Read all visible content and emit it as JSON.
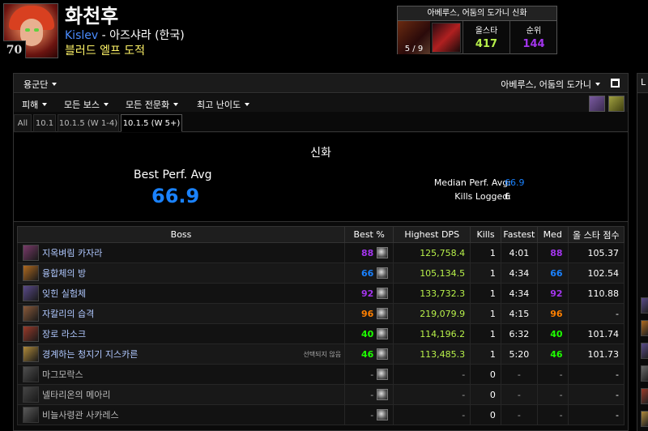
{
  "character": {
    "level": "70",
    "name": "화천후",
    "guild": "Kislev",
    "separator": " - ",
    "realm": "아즈샤라 (한국)",
    "class": "블러드 엘프 도적"
  },
  "raid_summary": {
    "title": "아베루스, 어둠의 도가니 신화",
    "progress": "5 / 9",
    "allstar_label": "올스타",
    "allstar_value": "417",
    "rank_label": "순위",
    "rank_value": "144"
  },
  "panel": {
    "metric_dropdown": "용군단",
    "raid_dropdown": "아베루스, 어둠의 도가니",
    "filters": [
      "피해",
      "모든 보스",
      "모든 전문화",
      "최고 난이도"
    ],
    "tabs": [
      "All",
      "10.1",
      "10.1.5 (W 1-4)",
      "10.1.5 (W 5+)"
    ],
    "active_tab": "10.1.5 (W 5+)"
  },
  "summary": {
    "difficulty": "신화",
    "best_perf_label": "Best Perf. Avg",
    "best_perf_value": "66.9",
    "median_label": "Median Perf. Avg:",
    "median_value": "66.9",
    "kills_label": "Kills Logged:",
    "kills_value": "6"
  },
  "table": {
    "headers": {
      "boss": "Boss",
      "best": "Best %",
      "dps": "Highest DPS",
      "kills": "Kills",
      "fastest": "Fastest",
      "med": "Med",
      "score": "올 스타 점수"
    },
    "rows": [
      {
        "boss": "지옥벼림 카자라",
        "note": "",
        "best": "88",
        "quality": "purple",
        "dps": "125,758.4",
        "kills": "1",
        "fastest": "4:01",
        "med": "88",
        "med_quality": "purple",
        "score": "105.37",
        "icon_color": "#7a3a6a",
        "dim": false
      },
      {
        "boss": "융합체의 방",
        "note": "",
        "best": "66",
        "quality": "blue",
        "dps": "105,134.5",
        "kills": "1",
        "fastest": "4:34",
        "med": "66",
        "med_quality": "blue",
        "score": "102.54",
        "icon_color": "#b06a20",
        "dim": false
      },
      {
        "boss": "잊힌 실험체",
        "note": "",
        "best": "92",
        "quality": "purple",
        "dps": "133,732.3",
        "kills": "1",
        "fastest": "4:34",
        "med": "92",
        "med_quality": "purple",
        "score": "110.88",
        "icon_color": "#5a4a8a",
        "dim": false
      },
      {
        "boss": "자칼리의 습격",
        "note": "",
        "best": "96",
        "quality": "orange",
        "dps": "219,079.9",
        "kills": "1",
        "fastest": "4:15",
        "med": "96",
        "med_quality": "orange",
        "score": "-",
        "icon_color": "#8a5a3a",
        "dim": false
      },
      {
        "boss": "장로 라소크",
        "note": "",
        "best": "40",
        "quality": "green",
        "dps": "114,196.2",
        "kills": "1",
        "fastest": "6:32",
        "med": "40",
        "med_quality": "green",
        "score": "101.74",
        "icon_color": "#9a3a2a",
        "dim": false
      },
      {
        "boss": "경계하는 청지기 지스카른",
        "note": "선택되지 않음",
        "best": "46",
        "quality": "green",
        "dps": "113,485.3",
        "kills": "1",
        "fastest": "5:20",
        "med": "46",
        "med_quality": "green",
        "score": "101.73",
        "icon_color": "#b08a3a",
        "dim": false
      },
      {
        "boss": "마그모락스",
        "note": "",
        "best": "-",
        "quality": "",
        "dps": "-",
        "kills": "0",
        "fastest": "-",
        "med": "-",
        "med_quality": "",
        "score": "-",
        "icon_color": "#6a6a6a",
        "dim": true
      },
      {
        "boss": "넬타리온의 메아리",
        "note": "",
        "best": "-",
        "quality": "",
        "dps": "-",
        "kills": "0",
        "fastest": "-",
        "med": "-",
        "med_quality": "",
        "score": "-",
        "icon_color": "#5a5a5a",
        "dim": true
      },
      {
        "boss": "비늘사령관 사카레스",
        "note": "",
        "best": "-",
        "quality": "",
        "dps": "-",
        "kills": "0",
        "fastest": "-",
        "med": "-",
        "med_quality": "",
        "score": "-",
        "icon_color": "#7a7a7a",
        "dim": true
      }
    ]
  },
  "side_panel": {
    "header_initial": "L"
  }
}
